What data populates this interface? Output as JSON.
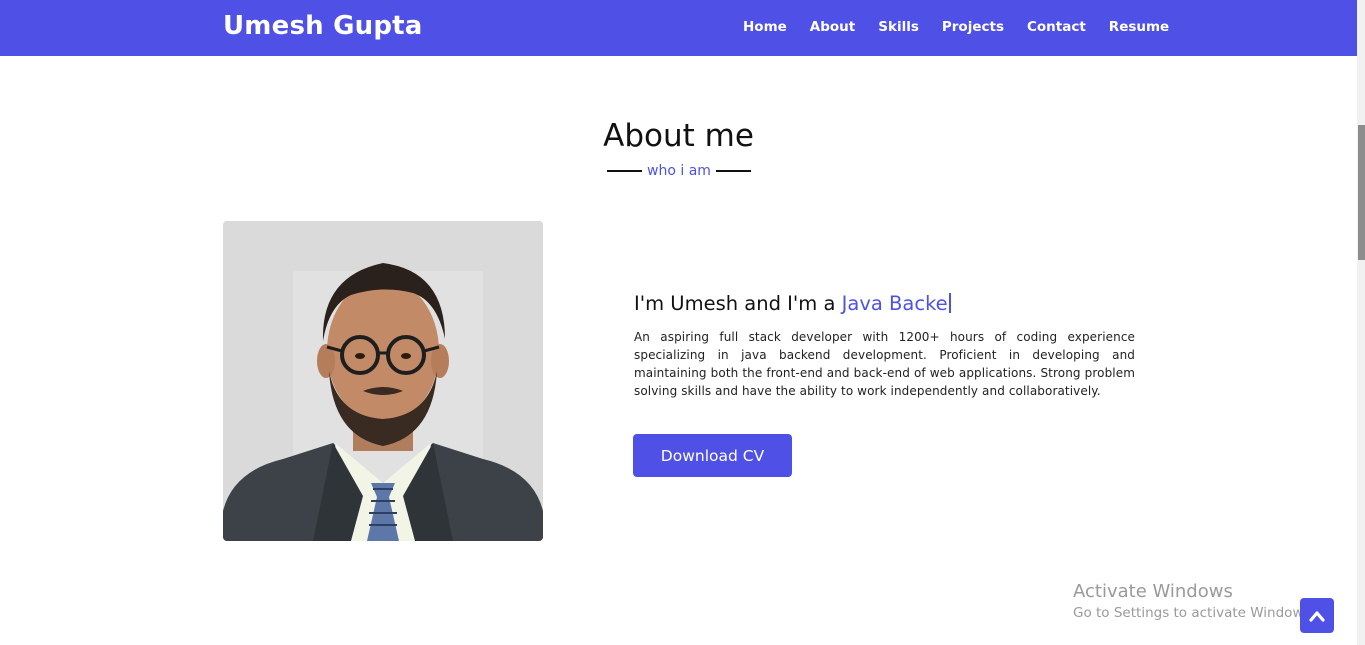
{
  "navbar": {
    "brand": "Umesh Gupta",
    "items": [
      "Home",
      "About",
      "Skills",
      "Projects",
      "Contact",
      "Resume"
    ],
    "color": "#4f51e6"
  },
  "about": {
    "title": "About me",
    "subtitle": "who i am",
    "intro_prefix": "I'm Umesh and I'm a ",
    "intro_typed": "Java Backe",
    "bio": "An aspiring full stack developer with 1200+ hours of coding experience specializing in java backend development. Proficient in developing and maintaining both the front-end and back-end of web applications. Strong problem solving skills and have the ability to work independently and collaboratively.",
    "cv_button": "Download CV",
    "photo_icon": "profile-photo"
  },
  "watermark": {
    "title": "Activate Windows",
    "subtitle": "Go to Settings to activate Windows."
  },
  "scroll_top_icon": "chevron-up-icon"
}
